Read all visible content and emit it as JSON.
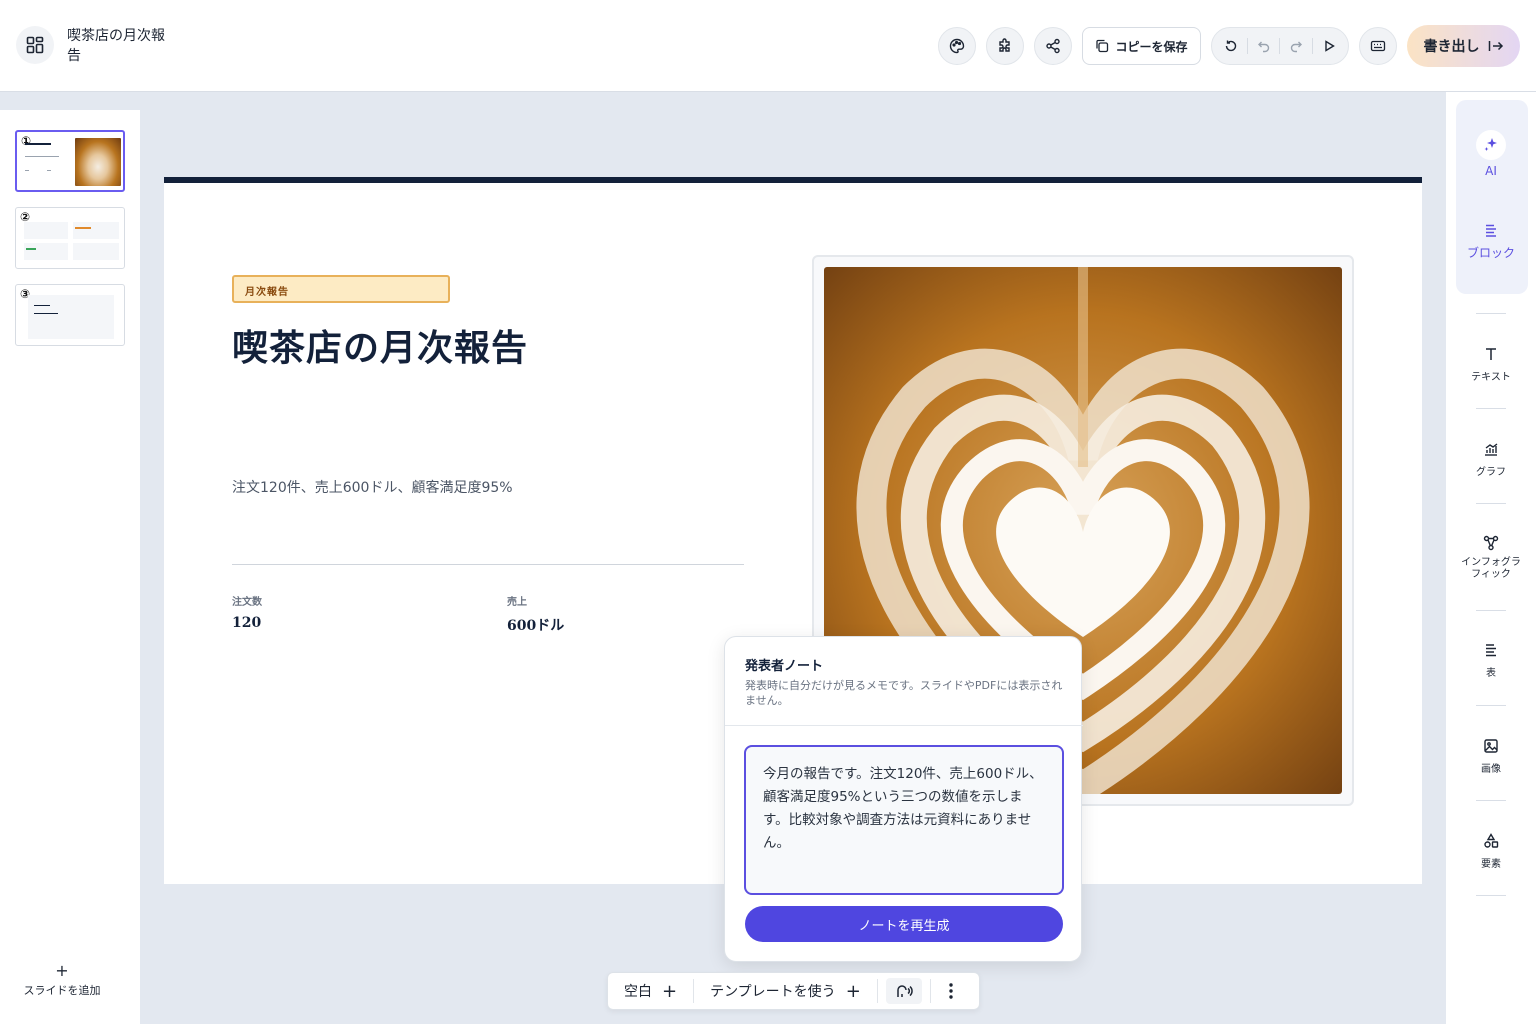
{
  "header": {
    "doc_title": "喫茶店の月次報告",
    "copy_save_label": "コピーを保存",
    "export_label": "書き出し"
  },
  "thumbnails": [
    {
      "number": "①",
      "active": true
    },
    {
      "number": "②",
      "active": false
    },
    {
      "number": "③",
      "active": false
    }
  ],
  "left_panel": {
    "add_slide_label": "スライドを追加"
  },
  "slide": {
    "badge": "月次報告",
    "title": "喫茶店の月次報告",
    "subtitle": "注文120件、売上600ドル、顧客満足度95%",
    "stats": [
      {
        "label": "注文数",
        "value": "120"
      },
      {
        "label": "売上",
        "value": "600ドル"
      }
    ]
  },
  "tools": {
    "ai": "AI",
    "block": "ブロック",
    "text": "テキスト",
    "chart": "グラフ",
    "infographic": "インフォグラフィック",
    "table": "表",
    "image": "画像",
    "elements": "要素"
  },
  "notes": {
    "heading": "発表者ノート",
    "description": "発表時に自分だけが見るメモです。スライドやPDFには表示されません。",
    "content": "今月の報告です。注文120件、売上600ドル、顧客満足度95%という三つの数値を示します。比較対象や調査方法は元資料にありません。",
    "regenerate_label": "ノートを再生成"
  },
  "bottom_bar": {
    "blank_label": "空白",
    "template_label": "テンプレートを使う"
  },
  "colors": {
    "accent": "#4f46e0",
    "slide_top_bar": "#13213a",
    "badge_bg": "#fdebc4",
    "badge_border": "#e8b15a"
  }
}
